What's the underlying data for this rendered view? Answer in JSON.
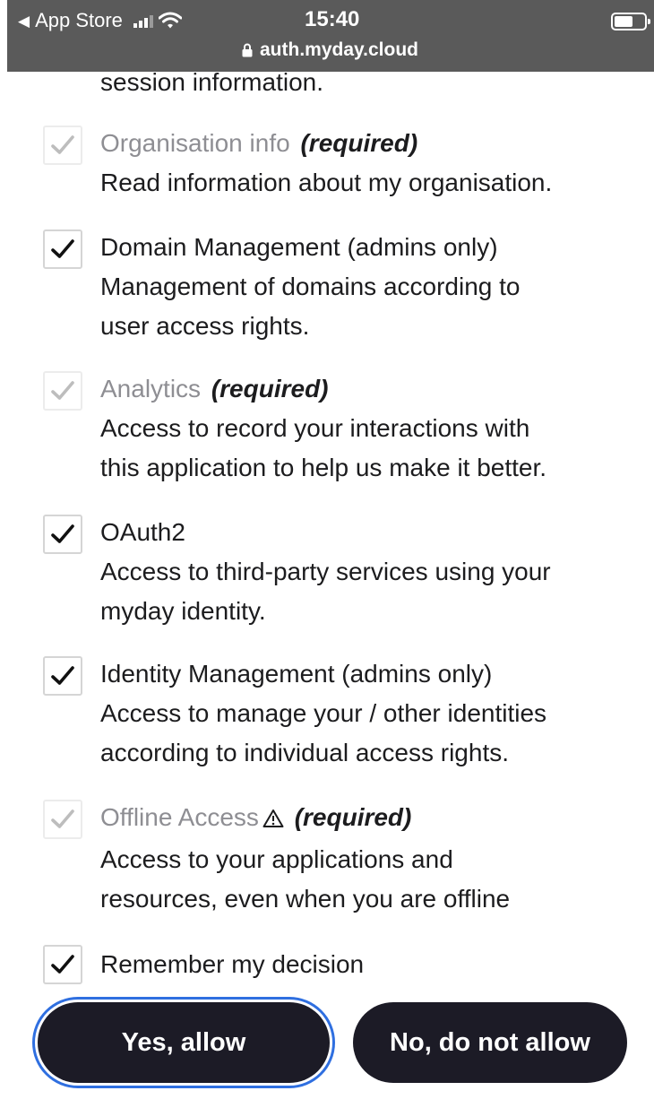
{
  "status_bar": {
    "back_label": "App Store",
    "time": "15:40",
    "url": "auth.myday.cloud"
  },
  "previous_line": "session information.",
  "scopes": [
    {
      "title": "Organisation info",
      "required_label": "(required)",
      "description_lines": [
        "Read information about my organisation."
      ],
      "checked": true,
      "disabled": true
    },
    {
      "title": "Domain Management (admins only)",
      "description_lines": [
        "Management of domains according to",
        "user access rights."
      ],
      "checked": true,
      "disabled": false
    },
    {
      "title": "Analytics",
      "required_label": "(required)",
      "description_lines": [
        "Access to record your interactions with",
        "this application to help us make it better."
      ],
      "checked": true,
      "disabled": true
    },
    {
      "title": "OAuth2",
      "description_lines": [
        "Access to third-party services using your",
        "myday identity."
      ],
      "checked": true,
      "disabled": false
    },
    {
      "title": "Identity Management (admins only)",
      "description_lines": [
        "Access to manage your / other identities",
        "according to individual access rights."
      ],
      "checked": true,
      "disabled": false
    },
    {
      "title": "Offline Access",
      "warning_icon": "warning-triangle-icon",
      "required_label": "(required)",
      "description_lines": [
        "Access to your applications and",
        "resources, even when you are offline"
      ],
      "checked": true,
      "disabled": true
    }
  ],
  "remember": {
    "label": "Remember my decision",
    "checked": true
  },
  "buttons": {
    "allow_label": "Yes, allow",
    "deny_label": "No, do not allow"
  },
  "colors": {
    "button_bg": "#1c1b26",
    "focus_ring": "#2f6fe0",
    "muted_text": "#8e8e93"
  }
}
